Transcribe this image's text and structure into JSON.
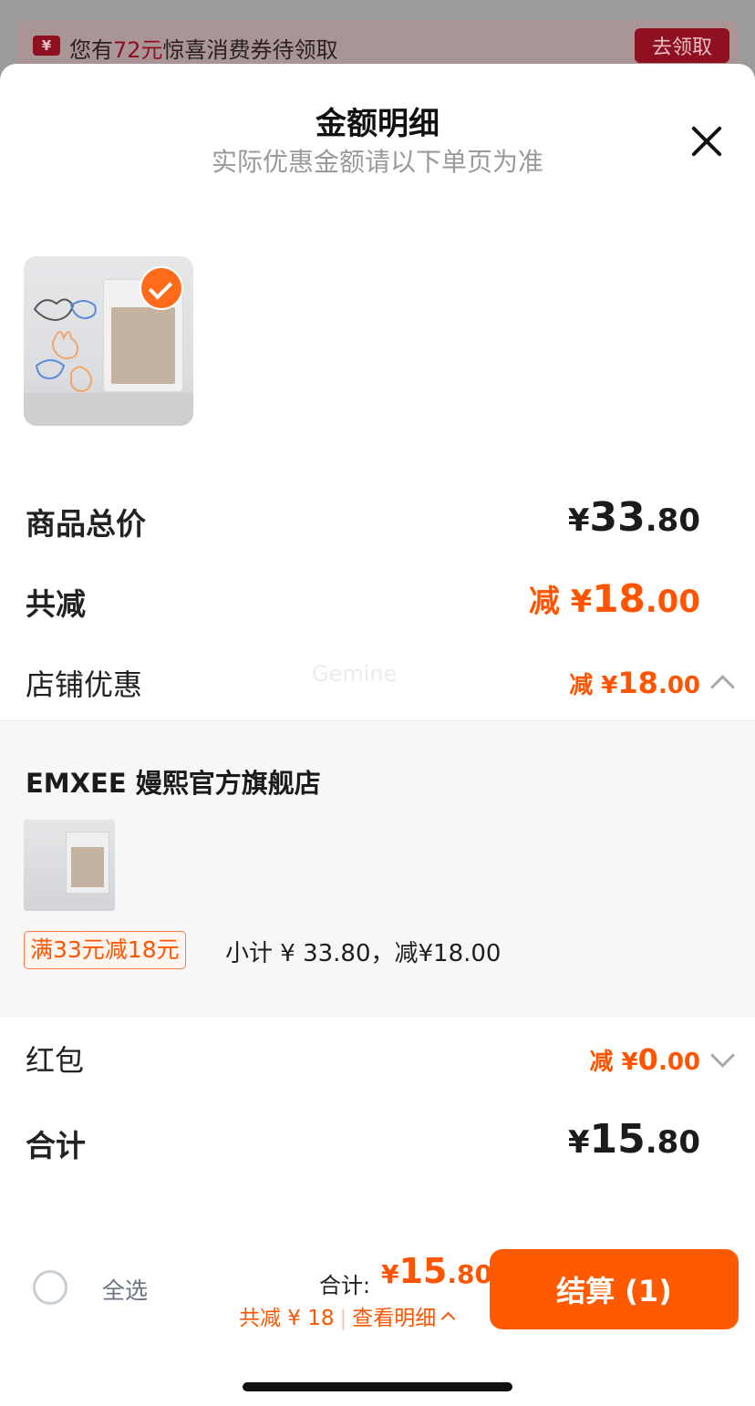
{
  "coupon_bar": {
    "prefix": "您有",
    "amount": "72",
    "unit": "元",
    "suffix": "惊喜消费券待领取",
    "icon": "¥",
    "button": "去领取"
  },
  "sheet": {
    "title": "金额明细",
    "subtitle": "实际优惠金额请以下单页为准"
  },
  "rows": {
    "goods_total": {
      "label": "商品总价",
      "currency": "¥",
      "int": "33",
      "dec": ".80"
    },
    "total_discount": {
      "label": "共减",
      "prefix": "减 ¥",
      "int": "18",
      "dec": ".00"
    },
    "store_discount": {
      "label": "店铺优惠",
      "prefix": "减 ¥",
      "int": "18",
      "dec": ".00"
    },
    "red_packet": {
      "label": "红包",
      "prefix": "减 ¥",
      "int": "0",
      "dec": ".00"
    },
    "sum": {
      "label": "合计",
      "currency": "¥",
      "int": "15",
      "dec": ".80"
    }
  },
  "watermark": "Gemine",
  "shop": {
    "name": "EMXEE 嫚熙官方旗舰店",
    "promo_tag": "满33元减18元",
    "subtotal_text": "小计 ¥ 33.80，减¥18.00"
  },
  "footer": {
    "select_all": "全选",
    "total_label": "合计:",
    "total_currency": "¥",
    "total_int": "15",
    "total_dec": ".80",
    "discount_text": "共减 ¥ 18",
    "view_detail": "查看明细",
    "checkout_label": "结算 (1)"
  },
  "colors": {
    "accent": "#ff5500",
    "checkout_bg": "#ff5a00"
  }
}
